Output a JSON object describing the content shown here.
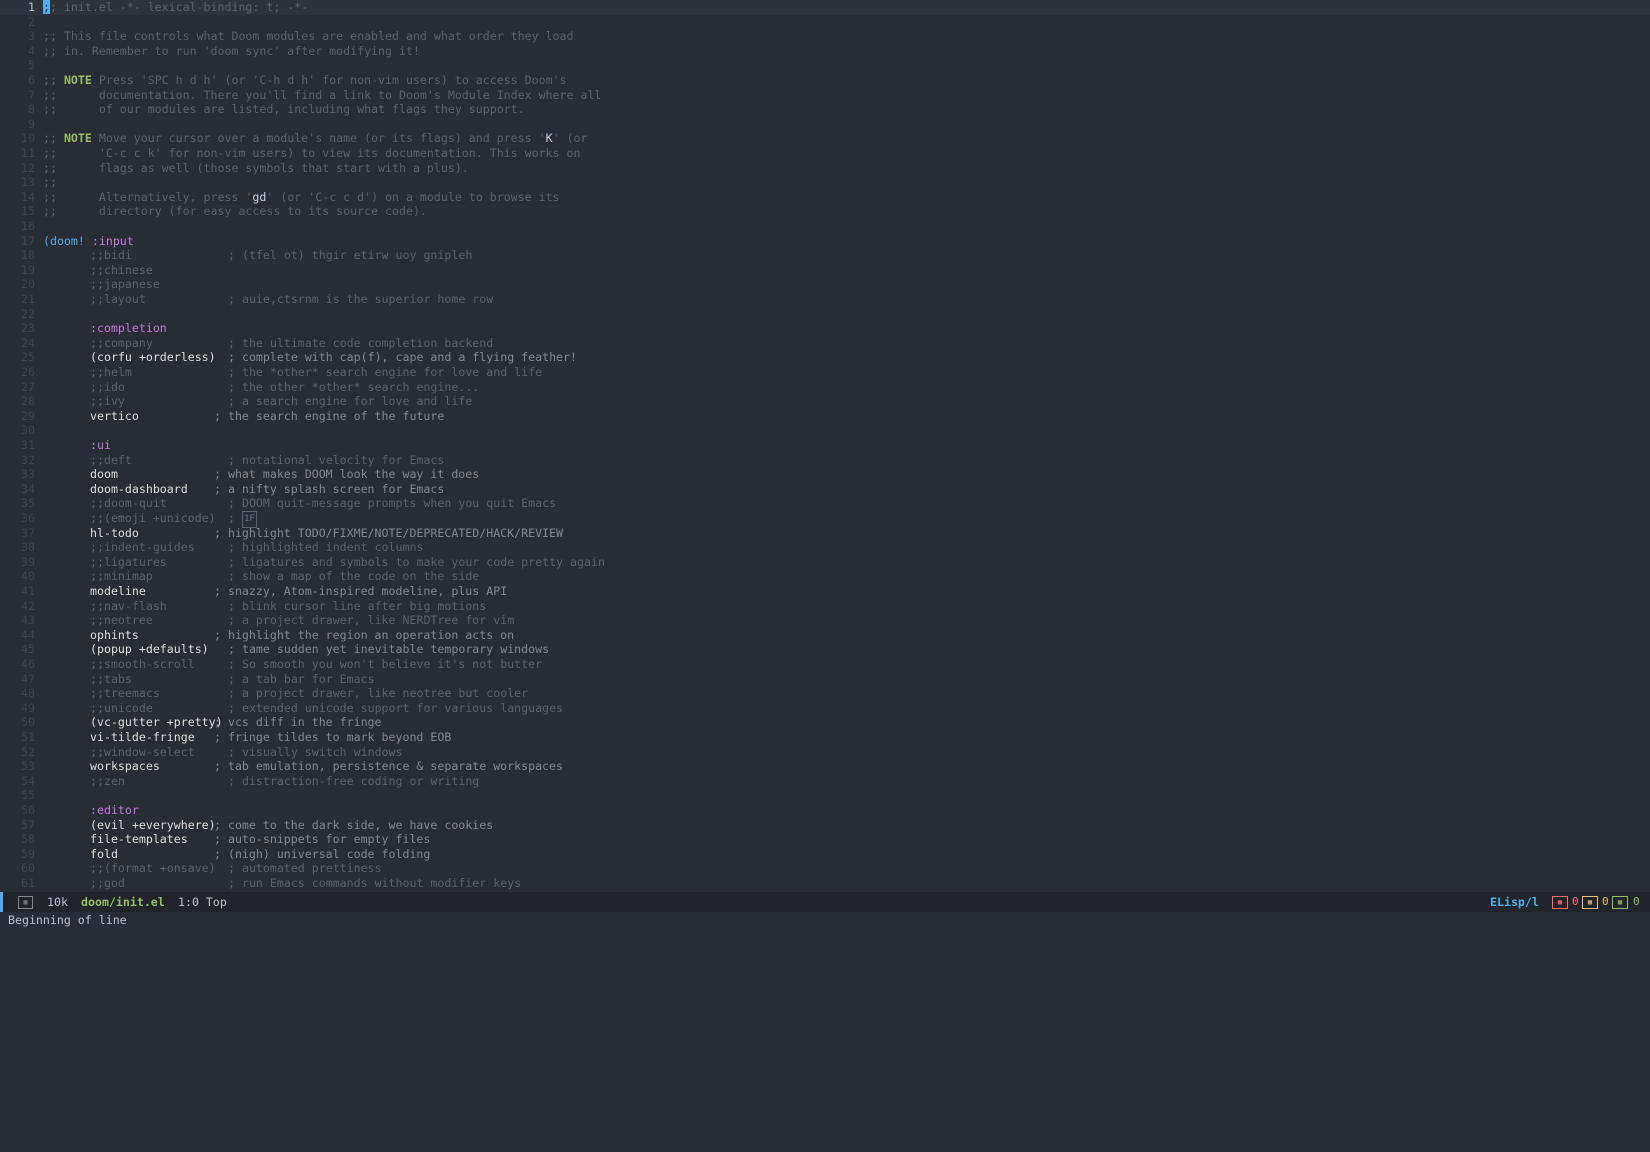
{
  "colors": {
    "bg": "#282c34",
    "accent": "#51afef",
    "keyword": "#c678dd",
    "comment": "#5b6268",
    "note": "#98be65"
  },
  "lines": [
    {
      "n": "1",
      "type": "header",
      "cursor": ";",
      "text": "; init.el -*- lexical-binding: t; -*-"
    },
    {
      "n": "2",
      "type": "blank"
    },
    {
      "n": "3",
      "type": "comment",
      "text": ";; This file controls what Doom modules are enabled and what order they load"
    },
    {
      "n": "4",
      "type": "comment",
      "text": ";; in. Remember to run 'doom sync' after modifying it!"
    },
    {
      "n": "5",
      "type": "blank"
    },
    {
      "n": "6",
      "type": "note",
      "pre": ";; ",
      "tag": "NOTE",
      "text": " Press 'SPC h d h' (or 'C-h d h' for non-vim users) to access Doom's"
    },
    {
      "n": "7",
      "type": "comment",
      "text": ";;      documentation. There you'll find a link to Doom's Module Index where all"
    },
    {
      "n": "8",
      "type": "comment",
      "text": ";;      of our modules are listed, including what flags they support."
    },
    {
      "n": "9",
      "type": "blank"
    },
    {
      "n": "10",
      "type": "note2",
      "pre": ";; ",
      "tag": "NOTE",
      "text": " Move your cursor over a module's name (or its flags) and press '",
      "key": "K",
      "post": "' (or"
    },
    {
      "n": "11",
      "type": "comment",
      "text": ";;      'C-c c k' for non-vim users) to view its documentation. This works on"
    },
    {
      "n": "12",
      "type": "comment",
      "text": ";;      flags as well (those symbols that start with a plus)."
    },
    {
      "n": "13",
      "type": "comment",
      "text": ";;"
    },
    {
      "n": "14",
      "type": "key",
      "pre": ";;      Alternatively, press '",
      "key": "gd",
      "post": "' (or 'C-c c d') on a module to browse its"
    },
    {
      "n": "15",
      "type": "comment",
      "text": ";;      directory (for easy access to its source code)."
    },
    {
      "n": "16",
      "type": "blank"
    },
    {
      "n": "17",
      "type": "doom",
      "paren": "(",
      "fn": "doom!",
      "kw": ":input"
    },
    {
      "n": "18",
      "type": "off",
      "mod": ";;bidi",
      "comment": "; (tfel ot) thgir etirw uoy gnipleh"
    },
    {
      "n": "19",
      "type": "off",
      "mod": ";;chinese",
      "comment": ""
    },
    {
      "n": "20",
      "type": "off",
      "mod": ";;japanese",
      "comment": ""
    },
    {
      "n": "21",
      "type": "off",
      "mod": ";;layout",
      "comment": "; auie,ctsrnm is the superior home row"
    },
    {
      "n": "22",
      "type": "blank"
    },
    {
      "n": "23",
      "type": "section",
      "kw": ":completion"
    },
    {
      "n": "24",
      "type": "off",
      "mod": ";;company",
      "comment": "; the ultimate code completion backend"
    },
    {
      "n": "25",
      "type": "on",
      "mod": "(corfu +orderless)",
      "comment": "; complete with cap(f), cape and a flying feather!"
    },
    {
      "n": "26",
      "type": "off",
      "mod": ";;helm",
      "comment": "; the *other* search engine for love and life"
    },
    {
      "n": "27",
      "type": "off",
      "mod": ";;ido",
      "comment": "; the other *other* search engine..."
    },
    {
      "n": "28",
      "type": "off",
      "mod": ";;ivy",
      "comment": "; a search engine for love and life"
    },
    {
      "n": "29",
      "type": "on2",
      "mod": "vertico",
      "comment": "; the search engine of the future"
    },
    {
      "n": "30",
      "type": "blank"
    },
    {
      "n": "31",
      "type": "section",
      "kw": ":ui"
    },
    {
      "n": "32",
      "type": "off",
      "mod": ";;deft",
      "comment": "; notational velocity for Emacs"
    },
    {
      "n": "33",
      "type": "on2",
      "mod": "doom",
      "comment": "; what makes DOOM look the way it does"
    },
    {
      "n": "34",
      "type": "on2",
      "mod": "doom-dashboard",
      "comment": "; a nifty splash screen for Emacs"
    },
    {
      "n": "35",
      "type": "off",
      "mod": ";;doom-quit",
      "comment": "; DOOM quit-message prompts when you quit Emacs"
    },
    {
      "n": "36",
      "type": "emoji",
      "mod": ";;(emoji +unicode)",
      "comment": "; ",
      "glyph": "1F"
    },
    {
      "n": "37",
      "type": "on2",
      "mod": "hl-todo",
      "comment": "; highlight TODO/FIXME/NOTE/DEPRECATED/HACK/REVIEW"
    },
    {
      "n": "38",
      "type": "off",
      "mod": ";;indent-guides",
      "comment": "; highlighted indent columns"
    },
    {
      "n": "39",
      "type": "off",
      "mod": ";;ligatures",
      "comment": "; ligatures and symbols to make your code pretty again"
    },
    {
      "n": "40",
      "type": "off",
      "mod": ";;minimap",
      "comment": "; show a map of the code on the side"
    },
    {
      "n": "41",
      "type": "on2",
      "mod": "modeline",
      "comment": "; snazzy, Atom-inspired modeline, plus API"
    },
    {
      "n": "42",
      "type": "off",
      "mod": ";;nav-flash",
      "comment": "; blink cursor line after big motions"
    },
    {
      "n": "43",
      "type": "off",
      "mod": ";;neotree",
      "comment": "; a project drawer, like NERDTree for vim"
    },
    {
      "n": "44",
      "type": "on2",
      "mod": "ophints",
      "comment": "; highlight the region an operation acts on"
    },
    {
      "n": "45",
      "type": "on",
      "mod": "(popup +defaults)",
      "comment": "; tame sudden yet inevitable temporary windows"
    },
    {
      "n": "46",
      "type": "off",
      "mod": ";;smooth-scroll",
      "comment": "; So smooth you won't believe it's not butter"
    },
    {
      "n": "47",
      "type": "off",
      "mod": ";;tabs",
      "comment": "; a tab bar for Emacs"
    },
    {
      "n": "48",
      "type": "off",
      "mod": ";;treemacs",
      "comment": "; a project drawer, like neotree but cooler"
    },
    {
      "n": "49",
      "type": "off",
      "mod": ";;unicode",
      "comment": "; extended unicode support for various languages"
    },
    {
      "n": "50",
      "type": "on3",
      "mod": "(vc-gutter +pretty)",
      "comment": "; vcs diff in the fringe"
    },
    {
      "n": "51",
      "type": "on2",
      "mod": "vi-tilde-fringe",
      "comment": "; fringe tildes to mark beyond EOB"
    },
    {
      "n": "52",
      "type": "off",
      "mod": ";;window-select",
      "comment": "; visually switch windows"
    },
    {
      "n": "53",
      "type": "on2",
      "mod": "workspaces",
      "comment": "; tab emulation, persistence & separate workspaces"
    },
    {
      "n": "54",
      "type": "off",
      "mod": ";;zen",
      "comment": "; distraction-free coding or writing"
    },
    {
      "n": "55",
      "type": "blank"
    },
    {
      "n": "56",
      "type": "section",
      "kw": ":editor"
    },
    {
      "n": "57",
      "type": "on3",
      "mod": "(evil +everywhere)",
      "comment": "; come to the dark side, we have cookies"
    },
    {
      "n": "58",
      "type": "on2",
      "mod": "file-templates",
      "comment": "; auto-snippets for empty files"
    },
    {
      "n": "59",
      "type": "on2",
      "mod": "fold",
      "comment": "; (nigh) universal code folding"
    },
    {
      "n": "60",
      "type": "off",
      "mod": ";;(format +onsave)",
      "comment": "; automated prettiness"
    },
    {
      "n": "61",
      "type": "off",
      "mod": ";;god",
      "comment": "; run Emacs commands without modifier keys"
    }
  ],
  "modeline": {
    "size": "10k",
    "buffer": "doom/init.el",
    "position": "1:0 Top",
    "major_mode": "ELisp/l",
    "errors": "0",
    "warnings": "0",
    "infos": "0"
  },
  "echo": "Beginning of line"
}
